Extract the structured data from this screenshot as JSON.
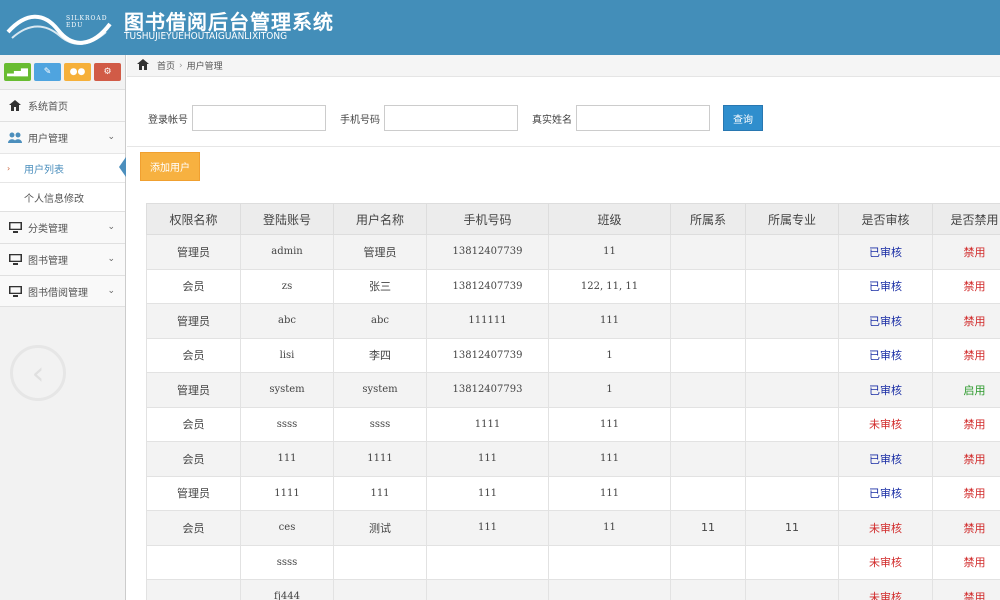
{
  "header": {
    "logo_text": "SILKROAD EDU",
    "title": "图书借阅后台管理系统",
    "subtitle": "TUSHUJIEYUEHOUTAIGUANLIXITONG"
  },
  "colors": {
    "header_bg": "#438eb9",
    "add_button": "#f7b140",
    "search_button": "#2f8ecd"
  },
  "sidebar": {
    "shortcut_icons": [
      "chart-icon",
      "pencil-icon",
      "users-icon",
      "cogs-icon"
    ],
    "items": [
      {
        "label": "系统首页",
        "icon": "home-icon"
      },
      {
        "label": "用户管理",
        "icon": "users-icon",
        "expanded": true,
        "children": [
          {
            "label": "用户列表",
            "active": true
          },
          {
            "label": "个人信息修改",
            "active": false
          }
        ]
      },
      {
        "label": "分类管理",
        "icon": "desktop-icon"
      },
      {
        "label": "图书管理",
        "icon": "desktop-icon"
      },
      {
        "label": "图书借阅管理",
        "icon": "desktop-icon"
      }
    ]
  },
  "breadcrumb": {
    "home": "首页",
    "current": "用户管理"
  },
  "search": {
    "login_label": "登录帐号",
    "login_value": "",
    "phone_label": "手机号码",
    "phone_value": "",
    "realname_label": "真实姓名",
    "realname_value": "",
    "button": "查询"
  },
  "toolbar": {
    "add_user": "添加用户"
  },
  "table": {
    "headers": [
      "权限名称",
      "登陆账号",
      "用户名称",
      "手机号码",
      "班级",
      "所属系",
      "所属专业",
      "是否审核",
      "是否禁用"
    ],
    "rows": [
      {
        "role": "管理员",
        "account": "admin",
        "name": "管理员",
        "phone": "13812407739",
        "class": "11",
        "dept": "",
        "major": "",
        "audit": "已审核",
        "audit_ok": true,
        "ban": "禁用"
      },
      {
        "role": "会员",
        "account": "zs",
        "name": "张三",
        "phone": "13812407739",
        "class": "122, 11, 11",
        "dept": "",
        "major": "",
        "audit": "已审核",
        "audit_ok": true,
        "ban": "禁用"
      },
      {
        "role": "管理员",
        "account": "abc",
        "name": "abc",
        "phone": "111111",
        "class": "111",
        "dept": "",
        "major": "",
        "audit": "已审核",
        "audit_ok": true,
        "ban": "禁用"
      },
      {
        "role": "会员",
        "account": "lisi",
        "name": "李四",
        "phone": "13812407739",
        "class": "1",
        "dept": "",
        "major": "",
        "audit": "已审核",
        "audit_ok": true,
        "ban": "禁用"
      },
      {
        "role": "管理员",
        "account": "system",
        "name": "system",
        "phone": "13812407793",
        "class": "1",
        "dept": "",
        "major": "",
        "audit": "已审核",
        "audit_ok": true,
        "ban": "启用"
      },
      {
        "role": "会员",
        "account": "ssss",
        "name": "ssss",
        "phone": "1111",
        "class": "111",
        "dept": "",
        "major": "",
        "audit": "未审核",
        "audit_ok": false,
        "ban": "禁用"
      },
      {
        "role": "会员",
        "account": "111",
        "name": "1111",
        "phone": "111",
        "class": "111",
        "dept": "",
        "major": "",
        "audit": "已审核",
        "audit_ok": true,
        "ban": "禁用"
      },
      {
        "role": "管理员",
        "account": "1111",
        "name": "111",
        "phone": "111",
        "class": "111",
        "dept": "",
        "major": "",
        "audit": "已审核",
        "audit_ok": true,
        "ban": "禁用"
      },
      {
        "role": "会员",
        "account": "ces",
        "name": "测试",
        "phone": "111",
        "class": "11",
        "dept": "11",
        "major": "11",
        "audit": "未审核",
        "audit_ok": false,
        "ban": "禁用"
      },
      {
        "role": "",
        "account": "ssss",
        "name": "",
        "phone": "",
        "class": "",
        "dept": "",
        "major": "",
        "audit": "未审核",
        "audit_ok": false,
        "ban": "禁用"
      },
      {
        "role": "",
        "account": "fj444",
        "name": "",
        "phone": "",
        "class": "",
        "dept": "",
        "major": "",
        "audit": "未审核",
        "audit_ok": false,
        "ban": "禁用"
      }
    ]
  }
}
